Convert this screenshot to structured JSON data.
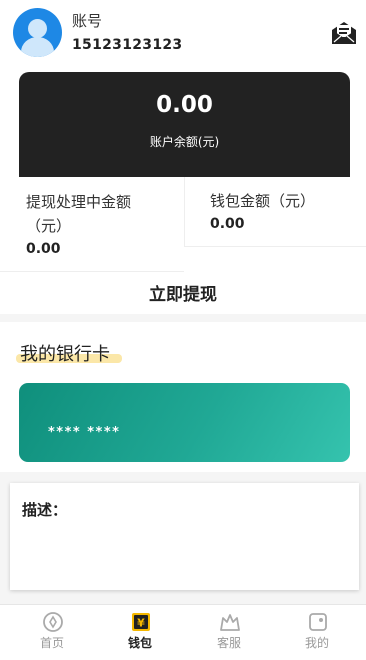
{
  "header": {
    "account_label": "账号",
    "phone": "15123123123",
    "mail_icon": "mail-open-icon"
  },
  "balance": {
    "value": "0.00",
    "label": "账户余额(元)"
  },
  "stats": {
    "processing_label": "提现处理中金额（元）",
    "processing_value": "0.00",
    "wallet_label": "钱包金额（元）",
    "wallet_value": "0.00"
  },
  "withdraw_label": "立即提现",
  "bank": {
    "title": "我的银行卡",
    "card_number": "**** ****"
  },
  "description": {
    "label": "描述："
  },
  "tabs": [
    {
      "label": "首页",
      "icon": "home-icon",
      "active": false
    },
    {
      "label": "钱包",
      "icon": "wallet-icon",
      "active": true
    },
    {
      "label": "客服",
      "icon": "service-icon",
      "active": false
    },
    {
      "label": "我的",
      "icon": "profile-icon",
      "active": false
    }
  ],
  "colors": {
    "card_dark": "#222222",
    "bank_card": "#20a895",
    "highlight": "#fbe7a8",
    "active_tab_icon": "#f5b800"
  }
}
